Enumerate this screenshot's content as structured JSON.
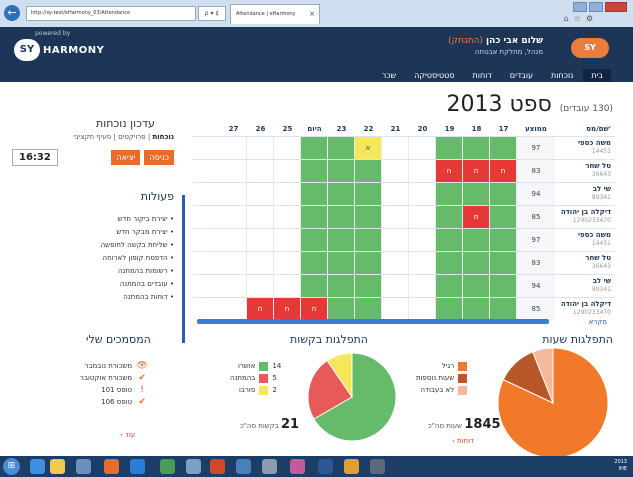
{
  "browser": {
    "address": "http://sy-test/eHarmony_03/Attendance",
    "address_controls": "ρ ▾ ¢",
    "tab_title": "Attendance | eHarmony",
    "tab_close": "×"
  },
  "header": {
    "powered_by": "powered by",
    "brand_badge": "SY",
    "brand_text": "HARMONY",
    "user_name": "שלום אבי כהן",
    "user_alias": "(התנתק)",
    "user_role": "מנהל, מחלקת אבטחה",
    "corner_logo": "SY"
  },
  "nav": [
    "בית",
    "נוכחות",
    "עובדים",
    "דוחות",
    "סטטיסטיקה",
    "שכר"
  ],
  "main": {
    "month_title": "ספט 2013",
    "worker_count": "(130 עובדים)"
  },
  "grid": {
    "col_name": "שם/מס'",
    "col_avg": "ממוצע",
    "days": [
      "17",
      "18",
      "19",
      "20",
      "21",
      "22",
      "23",
      "היום",
      "25",
      "26",
      "27"
    ],
    "rows": [
      {
        "name": "משה כספי",
        "id": "14451",
        "avg": "97",
        "cells": [
          "g",
          "g",
          "g",
          "",
          "",
          "y:א",
          "g",
          "g",
          "",
          "",
          ""
        ]
      },
      {
        "name": "טל שחר",
        "id": "36643",
        "avg": "83",
        "cells": [
          "r:ח",
          "r:ח",
          "r:ח",
          "",
          "",
          "g",
          "g",
          "g",
          "",
          "",
          ""
        ]
      },
      {
        "name": "שי לב",
        "id": "89341",
        "avg": "94",
        "cells": [
          "g",
          "g",
          "g",
          "",
          "",
          "g",
          "g",
          "g",
          "",
          "",
          ""
        ]
      },
      {
        "name": "דיקלה בן יהודה",
        "id": "1290233470",
        "avg": "85",
        "cells": [
          "g",
          "r:מ",
          "g",
          "",
          "",
          "g",
          "g",
          "g",
          "",
          "",
          ""
        ]
      },
      {
        "name": "משה כספי",
        "id": "14451",
        "avg": "97",
        "cells": [
          "g",
          "g",
          "g",
          "",
          "",
          "g",
          "g",
          "g",
          "",
          "",
          ""
        ]
      },
      {
        "name": "טל שחר",
        "id": "36643",
        "avg": "83",
        "cells": [
          "g",
          "g",
          "g",
          "",
          "",
          "g",
          "g",
          "g",
          "",
          "",
          ""
        ]
      },
      {
        "name": "שי לב",
        "id": "89341",
        "avg": "94",
        "cells": [
          "g",
          "g",
          "g",
          "",
          "",
          "g",
          "g",
          "g",
          "",
          "",
          ""
        ]
      },
      {
        "name": "דיקלה בן יהודה",
        "id": "1290233470",
        "avg": "85",
        "cells": [
          "g",
          "g",
          "g",
          "",
          "",
          "g",
          "g",
          "r:ח",
          "r:ח",
          "r:ח",
          ""
        ]
      }
    ],
    "more_link": "מקרא"
  },
  "side": {
    "title": "עדכון נוכחות",
    "tab_attendance": "נוכחות",
    "tab_projects": "פרויקטים",
    "tab_budget": "סעיף תקציבי",
    "clock": "16:32",
    "btn_enter": "כניסה",
    "btn_exit": "יציאה",
    "actions_title": "פעולות",
    "actions": [
      "יצירת ביקור חדש",
      "יצירת מבקר חדש",
      "שליחת בקשה לחופשה",
      "הדפסת קופון לארוחה",
      "רשומות בהמתנה",
      "עובדים בהמתנה",
      "דוחות בהמתנה"
    ]
  },
  "hours": {
    "title": "התפלגות שעות",
    "legend": [
      {
        "label": "רגיל",
        "color": "#f07a2a"
      },
      {
        "label": "שעות נוספות",
        "color": "#b9572a"
      },
      {
        "label": "לא בעבודה",
        "color": "#f6b89a"
      }
    ],
    "total_value": "1845",
    "total_label": "שעות סה\"כ",
    "link": "דוחות ›",
    "pie_values": [
      82,
      12,
      6
    ]
  },
  "requests": {
    "title": "התפלגות בקשות",
    "legend": [
      {
        "label": "אושרו",
        "value": "14",
        "color": "#66bb6a"
      },
      {
        "label": "בהמתנה",
        "value": "5",
        "color": "#e85a5a"
      },
      {
        "label": "סורבו",
        "value": "2",
        "color": "#f6e75a"
      }
    ],
    "total_value": "21",
    "total_label": "בקשות סה\"כ",
    "pie_values": [
      14,
      5,
      2
    ]
  },
  "docs": {
    "title": "המסמכים שלי",
    "items": [
      {
        "label": "משכורת נובמבר",
        "icon": "👁",
        "icon_name": "eye-icon",
        "color": "#e86b2c"
      },
      {
        "label": "משכורת אוקטובר",
        "icon": "✔",
        "icon_name": "check-icon",
        "color": "#e86b2c"
      },
      {
        "label": "טופס 101",
        "icon": "!",
        "icon_name": "exclamation-icon",
        "color": "#e53935"
      },
      {
        "label": "טופס 106",
        "icon": "✔",
        "icon_name": "check-icon",
        "color": "#e86b2c"
      }
    ],
    "more": "עוד ›"
  },
  "taskbar": {
    "time": "2013",
    "date": "IHE"
  },
  "colors": {
    "header": "#1d3557",
    "accent": "#e86b2c",
    "green": "#66bb6a",
    "red": "#e53935",
    "yellow": "#f6e75a"
  }
}
